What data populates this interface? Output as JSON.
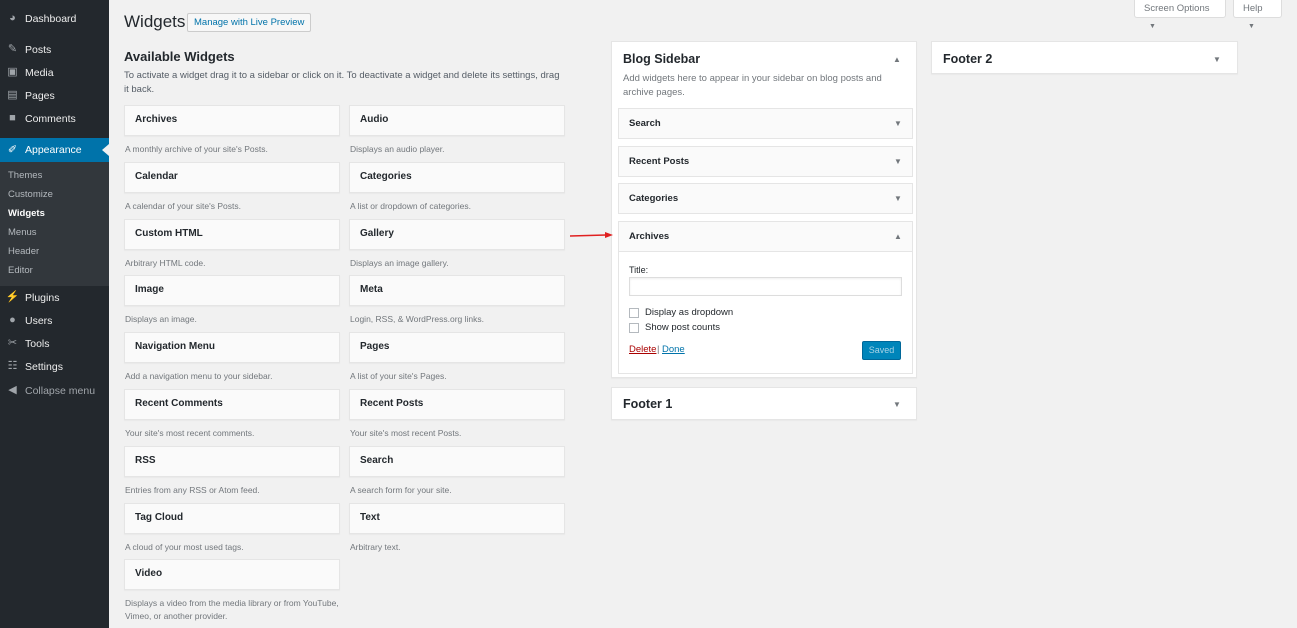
{
  "admin_menu": {
    "items": [
      {
        "label": "Dashboard",
        "icon": "dashboard-icon"
      },
      {
        "label": "Posts",
        "icon": "pin-icon"
      },
      {
        "label": "Media",
        "icon": "media-icon"
      },
      {
        "label": "Pages",
        "icon": "page-icon"
      },
      {
        "label": "Comments",
        "icon": "comment-icon"
      },
      {
        "label": "Appearance",
        "icon": "brush-icon"
      },
      {
        "label": "Plugins",
        "icon": "plug-icon"
      },
      {
        "label": "Users",
        "icon": "user-icon"
      },
      {
        "label": "Tools",
        "icon": "wrench-icon"
      },
      {
        "label": "Settings",
        "icon": "settings-icon"
      }
    ],
    "submenu": [
      "Themes",
      "Customize",
      "Widgets",
      "Menus",
      "Header",
      "Editor"
    ],
    "collapse": "Collapse menu",
    "accent_color": "#0073aa"
  },
  "header": {
    "title": "Widgets",
    "live_preview": "Manage with Live Preview",
    "screen_options": "Screen Options",
    "help": "Help",
    "dropdown_glyph": "▼"
  },
  "available": {
    "title": "Available Widgets",
    "description": "To activate a widget drag it to a sidebar or click on it. To deactivate a widget and delete its settings, drag it back.",
    "widgets": [
      {
        "name": "Archives",
        "desc": "A monthly archive of your site's Posts."
      },
      {
        "name": "Audio",
        "desc": "Displays an audio player."
      },
      {
        "name": "Calendar",
        "desc": "A calendar of your site's Posts."
      },
      {
        "name": "Categories",
        "desc": "A list or dropdown of categories."
      },
      {
        "name": "Custom HTML",
        "desc": "Arbitrary HTML code."
      },
      {
        "name": "Gallery",
        "desc": "Displays an image gallery."
      },
      {
        "name": "Image",
        "desc": "Displays an image."
      },
      {
        "name": "Meta",
        "desc": "Login, RSS, & WordPress.org links."
      },
      {
        "name": "Navigation Menu",
        "desc": "Add a navigation menu to your sidebar."
      },
      {
        "name": "Pages",
        "desc": "A list of your site's Pages."
      },
      {
        "name": "Recent Comments",
        "desc": "Your site's most recent comments."
      },
      {
        "name": "Recent Posts",
        "desc": "Your site's most recent Posts."
      },
      {
        "name": "RSS",
        "desc": "Entries from any RSS or Atom feed."
      },
      {
        "name": "Search",
        "desc": "A search form for your site."
      },
      {
        "name": "Tag Cloud",
        "desc": "A cloud of your most used tags."
      },
      {
        "name": "Text",
        "desc": "Arbitrary text."
      },
      {
        "name": "Video",
        "desc": "Displays a video from the media library or from YouTube, Vimeo, or another provider."
      }
    ]
  },
  "sidebars": {
    "blog": {
      "name": "Blog Sidebar",
      "description": "Add widgets here to appear in your sidebar on blog posts and archive pages.",
      "widgets": [
        "Search",
        "Recent Posts",
        "Categories",
        "Archives"
      ],
      "archives_form": {
        "title_label": "Title:",
        "title_value": "",
        "dropdown_label": "Display as dropdown",
        "dropdown_checked": false,
        "counts_label": "Show post counts",
        "counts_checked": false,
        "delete": "Delete",
        "separator": "|",
        "done": "Done",
        "saved": "Saved"
      }
    },
    "footer1": {
      "name": "Footer 1"
    },
    "footer2": {
      "name": "Footer 2"
    }
  },
  "glyphs": {
    "up": "▲",
    "down": "▼"
  },
  "annotation_color": "#e02020"
}
